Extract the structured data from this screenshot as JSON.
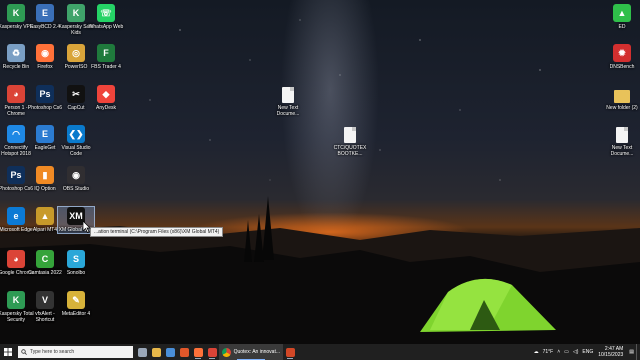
{
  "desktop": {
    "icons_left": [
      {
        "label": "Kaspersky VPN",
        "icon": "kaspersky-vpn-icon",
        "color": "#2e9b54",
        "glyph": "K"
      },
      {
        "label": "EasyBCD 2.4",
        "icon": "easybcd-icon",
        "color": "#3a6fb8",
        "glyph": "E"
      },
      {
        "label": "Kaspersky Safe Kids",
        "icon": "kaspersky-safe-kids-icon",
        "color": "#3fa36a",
        "glyph": "K"
      },
      {
        "label": "WhatsApp Web",
        "icon": "whatsapp-icon",
        "color": "#25d366",
        "glyph": "☏"
      },
      {
        "label": "Recycle Bin",
        "icon": "recycle-bin-icon",
        "color": "#7a9fc4",
        "glyph": "♻"
      },
      {
        "label": "Firefox",
        "icon": "firefox-icon",
        "color": "#ff7139",
        "glyph": "◉"
      },
      {
        "label": "PowerISO",
        "icon": "poweriso-icon",
        "color": "#d9a43a",
        "glyph": "◎"
      },
      {
        "label": "FBS Trader 4",
        "icon": "fbs-trader-icon",
        "color": "#1f7a3c",
        "glyph": "F"
      },
      {
        "label": "Person 1 - Chrome",
        "icon": "chrome-icon",
        "color": "#db4437",
        "glyph": "◕"
      },
      {
        "label": "Photoshop Cs6",
        "icon": "photoshop-icon",
        "color": "#0f2f5a",
        "glyph": "Ps"
      },
      {
        "label": "CapCut",
        "icon": "capcut-icon",
        "color": "#111111",
        "glyph": "✂"
      },
      {
        "label": "AnyDesk",
        "icon": "anydesk-icon",
        "color": "#ef443b",
        "glyph": "◆"
      },
      {
        "label": "Connectify Hotspot 2018",
        "icon": "connectify-icon",
        "color": "#1e88e5",
        "glyph": "◠"
      },
      {
        "label": "EagleGet",
        "icon": "eagleget-icon",
        "color": "#2b7bd1",
        "glyph": "E"
      },
      {
        "label": "Visual Studio Code",
        "icon": "vscode-icon",
        "color": "#0a7acc",
        "glyph": "❮❯"
      },
      {
        "label": "Photoshop Cs6",
        "icon": "photoshop-icon",
        "color": "#0f2f5a",
        "glyph": "Ps"
      },
      {
        "label": "IQ Option",
        "icon": "iq-option-icon",
        "color": "#f08a24",
        "glyph": "▮"
      },
      {
        "label": "OBS Studio",
        "icon": "obs-studio-icon",
        "color": "#302e31",
        "glyph": "◉"
      },
      {
        "label": "Microsoft Edge",
        "icon": "edge-icon",
        "color": "#0c7ad4",
        "glyph": "e"
      },
      {
        "label": "Alpari MT4",
        "icon": "alpari-mt4-icon",
        "color": "#c89a2a",
        "glyph": "▲"
      },
      {
        "label": "XM Global MT4",
        "icon": "xm-mt4-icon",
        "color": "#111111",
        "glyph": "XM"
      },
      {
        "label": "Google Chrome",
        "icon": "chrome-icon",
        "color": "#db4437",
        "glyph": "◕"
      },
      {
        "label": "Camtasia 2022",
        "icon": "camtasia-icon",
        "color": "#35a33a",
        "glyph": "C"
      },
      {
        "label": "Sonolbo",
        "icon": "sonolbo-icon",
        "color": "#2aa7d8",
        "glyph": "S"
      },
      {
        "label": "Kaspersky Total Security",
        "icon": "kaspersky-total-security-icon",
        "color": "#2e9b54",
        "glyph": "K"
      },
      {
        "label": "vfxAlert - Shortcut",
        "icon": "vfxalert-icon",
        "color": "#333333",
        "glyph": "V"
      },
      {
        "label": "MetaEditor 4",
        "icon": "metaeditor-icon",
        "color": "#d7b23a",
        "glyph": "✎"
      }
    ],
    "icons_middle": [
      {
        "label": "New Text Docume...",
        "icon": "text-document-icon"
      },
      {
        "label": "CTC/QUOTEX BOOTKE...",
        "icon": "text-document-icon"
      }
    ],
    "icons_right": [
      {
        "label": "ED",
        "icon": "ed-icon",
        "color": "#2fbf4a",
        "glyph": "▲"
      },
      {
        "label": "DNSBench",
        "icon": "dnsbench-icon",
        "color": "#d32f2f",
        "glyph": "✹"
      },
      {
        "label": "New folder (2)",
        "icon": "folder-icon"
      },
      {
        "label": "New Text Docume...",
        "icon": "text-document-icon"
      }
    ],
    "tooltip": "...ation terminal (C:\\Program Files (x86)\\XM Global MT4)"
  },
  "taskbar": {
    "search_placeholder": "Type here to search",
    "pinned": [
      {
        "icon": "task-view-icon",
        "color": "#9aa7b8"
      },
      {
        "icon": "file-explorer-icon",
        "color": "#e8b84a"
      },
      {
        "icon": "store-icon",
        "color": "#4a8fd9"
      },
      {
        "icon": "office-icon",
        "color": "#e2572a"
      },
      {
        "icon": "firefox-icon",
        "color": "#ff7139"
      },
      {
        "icon": "chrome-icon",
        "color": "#db4437"
      }
    ],
    "active_app": "Quotex: An innovat...",
    "after_active": [
      {
        "icon": "powerpoint-icon",
        "color": "#d24726"
      }
    ],
    "weather": "71°F",
    "language": "ENG",
    "time": "2:47 AM",
    "date": "10/15/2023"
  }
}
